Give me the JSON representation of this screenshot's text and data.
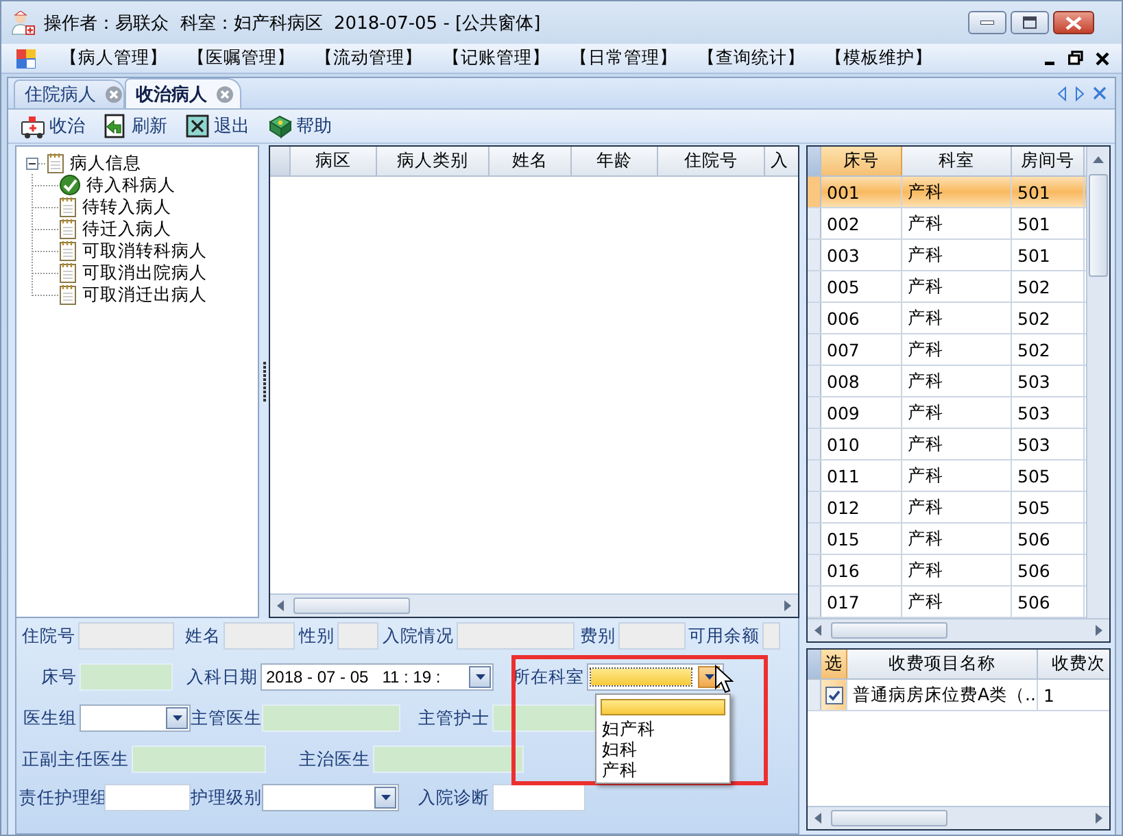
{
  "window": {
    "title": "操作者：易联众  科室：妇产科病区  2018-07-05 - [公共窗体]"
  },
  "menu": [
    "【病人管理】",
    "【医嘱管理】",
    "【流动管理】",
    "【记账管理】",
    "【日常管理】",
    "【查询统计】",
    "【模板维护】"
  ],
  "tabs": [
    {
      "label": "住院病人",
      "selected": false
    },
    {
      "label": "收治病人",
      "selected": true
    }
  ],
  "toolbar": [
    {
      "label": "收治",
      "kind": "admit"
    },
    {
      "label": "刷新",
      "kind": "refresh"
    },
    {
      "label": "退出",
      "kind": "exit"
    },
    {
      "label": "帮助",
      "kind": "help"
    }
  ],
  "tree": {
    "label": "病人信息",
    "expanded": true,
    "children": [
      {
        "label": "待入科病人",
        "checked": true
      },
      {
        "label": "待转入病人",
        "checked": false
      },
      {
        "label": "待迁入病人",
        "checked": false
      },
      {
        "label": "可取消转科病人",
        "checked": false
      },
      {
        "label": "可取消出院病人",
        "checked": false
      },
      {
        "label": "可取消迁出病人",
        "checked": false
      }
    ]
  },
  "patient_grid": {
    "columns": [
      "病区",
      "病人类别",
      "姓名",
      "年龄",
      "住院号",
      "入"
    ]
  },
  "bed_grid": {
    "columns": [
      {
        "label": "床号",
        "selected": true
      },
      {
        "label": "科室",
        "selected": false
      },
      {
        "label": "房间号",
        "selected": false
      }
    ],
    "rows": [
      {
        "cells": [
          "001",
          "产科",
          "501"
        ],
        "selected": true
      },
      {
        "cells": [
          "002",
          "产科",
          "501"
        ],
        "selected": false
      },
      {
        "cells": [
          "003",
          "产科",
          "501"
        ],
        "selected": false
      },
      {
        "cells": [
          "005",
          "产科",
          "502"
        ],
        "selected": false
      },
      {
        "cells": [
          "006",
          "产科",
          "502"
        ],
        "selected": false
      },
      {
        "cells": [
          "007",
          "产科",
          "502"
        ],
        "selected": false
      },
      {
        "cells": [
          "008",
          "产科",
          "503"
        ],
        "selected": false
      },
      {
        "cells": [
          "009",
          "产科",
          "503"
        ],
        "selected": false
      },
      {
        "cells": [
          "010",
          "产科",
          "503"
        ],
        "selected": false
      },
      {
        "cells": [
          "011",
          "产科",
          "505"
        ],
        "selected": false
      },
      {
        "cells": [
          "012",
          "产科",
          "505"
        ],
        "selected": false
      },
      {
        "cells": [
          "015",
          "产科",
          "506"
        ],
        "selected": false
      },
      {
        "cells": [
          "016",
          "产科",
          "506"
        ],
        "selected": false
      },
      {
        "cells": [
          "017",
          "产科",
          "506"
        ],
        "selected": false
      }
    ]
  },
  "form": {
    "rows": [
      [
        {
          "label": "住院号",
          "kind": "readonly"
        },
        {
          "label": "姓名",
          "kind": "readonly"
        },
        {
          "label": "性别",
          "kind": "readonly"
        },
        {
          "label": "入院情况",
          "kind": "readonly"
        },
        {
          "label": "费别",
          "kind": "readonly"
        },
        {
          "label": "可用余额",
          "kind": "readonly"
        }
      ],
      [
        {
          "label": "床号",
          "kind": "filled"
        },
        {
          "label": "入科日期",
          "kind": "datetime",
          "value": "2018 - 07 - 05   11 : 19 :"
        },
        {
          "label": "所在科室",
          "kind": "dept",
          "open": true
        }
      ],
      [
        {
          "label": "医生组",
          "kind": "combo"
        },
        {
          "label": "主管医生",
          "kind": "filled"
        },
        {
          "label": "主管护士",
          "kind": "filled"
        }
      ],
      [
        {
          "label": "正副主任医生",
          "kind": "filled"
        },
        {
          "label": "主治医生",
          "kind": "filled"
        }
      ],
      [
        {
          "label": "责任护理组",
          "kind": "text"
        },
        {
          "label": "护理级别",
          "kind": "combo"
        },
        {
          "label": "入院诊断",
          "kind": "text"
        }
      ]
    ],
    "dropdown": {
      "blank_highlighted": true,
      "options": [
        "妇产科",
        "妇科",
        "产科"
      ]
    }
  },
  "fee_grid": {
    "check_column": {
      "label": "选",
      "selected": true
    },
    "columns": [
      {
        "label": "收费项目名称",
        "selected": false
      },
      {
        "label": "收费次",
        "selected": false
      }
    ],
    "rows": [
      {
        "checked": true,
        "cells": [
          "普通病房床位费A类（...",
          "1"
        ]
      }
    ]
  }
}
